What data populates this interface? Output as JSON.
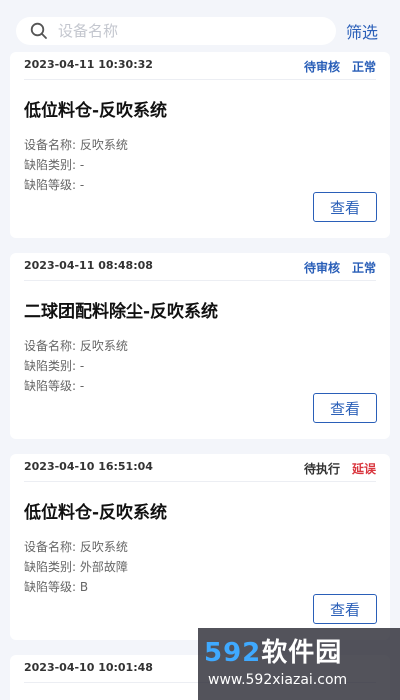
{
  "search": {
    "placeholder": "设备名称",
    "value": ""
  },
  "filter_label": "筛选",
  "colors": {
    "accent": "#2a5fb8",
    "alert": "#d9363e",
    "neutral": "#333333"
  },
  "field_labels": {
    "device": "设备名称:",
    "category": "缺陷类别:",
    "level": "缺陷等级:"
  },
  "view_label": "查看",
  "cards": [
    {
      "time": "2023-04-11 10:30:32",
      "status": "待审核",
      "state": "正常",
      "title": "低位料仓-反吹系统",
      "device": "反吹系统",
      "category": "-",
      "level": "-"
    },
    {
      "time": "2023-04-11 08:48:08",
      "status": "待审核",
      "state": "正常",
      "title": "二球团配料除尘-反吹系统",
      "device": "反吹系统",
      "category": "-",
      "level": "-"
    },
    {
      "time": "2023-04-10 16:51:04",
      "status": "待执行",
      "state": "延误",
      "title": "低位料仓-反吹系统",
      "device": "反吹系统",
      "category": "外部故障",
      "level": "B"
    },
    {
      "time": "2023-04-10 10:01:48",
      "status": "",
      "state": "",
      "title": "",
      "device": "",
      "category": "",
      "level": ""
    }
  ],
  "watermark": {
    "logo_num": "592",
    "logo_text": "软件园",
    "url": "www.592xiazai.com"
  }
}
